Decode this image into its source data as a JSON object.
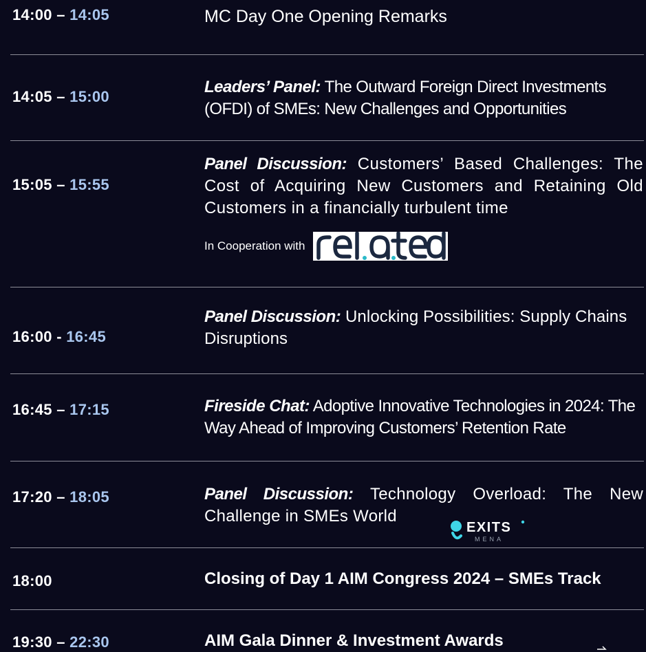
{
  "sessions": [
    {
      "start": "14:00",
      "sep": " – ",
      "end": "14:05",
      "title": "MC Day One Opening Remarks"
    },
    {
      "start": "14:05",
      "sep": " – ",
      "end": "15:00",
      "label": "Leaders’ Panel:",
      "title": " The Outward Foreign Direct Investments (OFDI) of SMEs: New Challenges and Opportunities"
    },
    {
      "start": "15:05",
      "sep": " – ",
      "end": "15:55",
      "label": "Panel Discussion:",
      "title": " Customers’ Based Challenges: The Cost of Acquiring New Customers and Retaining Old Customers in a financially turbulent time",
      "coop_text": "In Cooperation with",
      "partner_logo": "related"
    },
    {
      "start": "16:00",
      "sep": " - ",
      "end": "16:45",
      "label": "Panel Discussion:",
      "title": " Unlocking Possibilities: Supply Chains Disruptions"
    },
    {
      "start": "16:45",
      "sep": " – ",
      "end": "17:15",
      "label": "Fireside Chat:",
      "title": " Adoptive Innovative Technologies in 2024: The Way Ahead of Improving Customers’ Retention Rate"
    },
    {
      "start": "17:20",
      "sep": " – ",
      "end": "18:05",
      "label": "Panel Discussion:",
      "title": " Technology Overload: The New Challenge in SMEs World",
      "partner_logo": "EXITS MENA",
      "partner_logo_word": "EXITS",
      "partner_logo_sub": "MENA"
    },
    {
      "start": "18:00",
      "title": "Closing of  Day 1 AIM Congress 2024 – SMEs Track"
    },
    {
      "start": "19:30",
      "sep": " – ",
      "end": "22:30",
      "title": "AIM Gala Dinner & Investment Awards"
    }
  ],
  "colors": {
    "background": "#0a0a1c",
    "time_start": "#ffffff",
    "time_end": "#a9c6ee",
    "divider": "#8d8d98"
  }
}
